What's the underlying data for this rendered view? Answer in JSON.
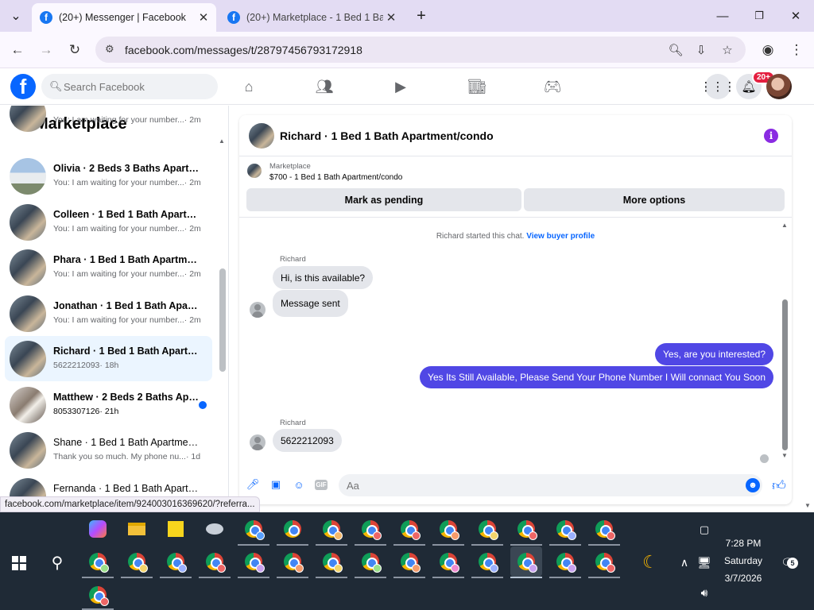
{
  "browser": {
    "tabs": [
      {
        "title": "(20+) Messenger | Facebook",
        "active": true
      },
      {
        "title": "(20+) Marketplace - 1 Bed 1 Bat",
        "active": false
      }
    ],
    "url": "facebook.com/messages/t/28797456793172918",
    "status_url": "facebook.com/marketplace/item/924003016369620/?referra..."
  },
  "facebook": {
    "search_placeholder": "Search Facebook",
    "notification_badge": "20+",
    "brand_color": "#0866ff"
  },
  "sidebar": {
    "title": "Marketplace",
    "conversations": [
      {
        "name": "",
        "preview": "You: I am waiting for your number...",
        "time": " · 2m",
        "unread": false,
        "partial": true
      },
      {
        "name": "Olivia · 2 Beds 3 Baths Apartme...",
        "preview": "You: I am waiting for your number...",
        "time": " · 2m",
        "unread": false
      },
      {
        "name": "Colleen · 1 Bed 1 Bath Apartmen...",
        "preview": "You: I am waiting for your number...",
        "time": " · 2m",
        "unread": false
      },
      {
        "name": "Phara · 1 Bed 1 Bath Apartment/...",
        "preview": "You: I am waiting for your number...",
        "time": " · 2m",
        "unread": false
      },
      {
        "name": "Jonathan · 1 Bed 1 Bath Apartm...",
        "preview": "You: I am waiting for your number...",
        "time": " · 2m",
        "unread": false
      },
      {
        "name": "Richard · 1 Bed 1 Bath Apartmen...",
        "preview": "5622212093",
        "time": " · 18h",
        "unread": false,
        "active": true
      },
      {
        "name": "Matthew · 2 Beds 2 Baths Apa...",
        "preview": "8053307126",
        "time": " · 21h",
        "unread": true
      },
      {
        "name": "Shane · 1 Bed 1 Bath Apartment...",
        "preview": "Thank you so much. My phone nu...",
        "time": " · 1d",
        "unread": false
      },
      {
        "name": "Fernanda · 1 Bed 1 Bath Apartm...",
        "preview": "",
        "time": "",
        "unread": false
      }
    ]
  },
  "chat": {
    "title": "Richard · 1 Bed 1 Bath Apartment/condo",
    "listing": {
      "source": "Marketplace",
      "description": "$700 - 1 Bed 1 Bath Apartment/condo",
      "mark_pending_label": "Mark as pending",
      "more_options_label": "More options"
    },
    "system_note": "Richard started this chat.",
    "system_link": "View buyer profile",
    "messages": [
      {
        "sender": "Richard",
        "text": "Hi, is this available?",
        "dir": "in"
      },
      {
        "sender": "",
        "text": "Message sent",
        "dir": "in"
      },
      {
        "sender": "",
        "text": "Yes, are you interested?",
        "dir": "out"
      },
      {
        "sender": "",
        "text": "Yes Its Still Available, Please Send Your Phone Number I Will connact You Soon",
        "dir": "out"
      },
      {
        "sender": "Richard",
        "text": "5622212093",
        "dir": "in"
      }
    ],
    "composer_placeholder": "Aa",
    "outgoing_color": "#5047e5"
  },
  "taskbar": {
    "time": "7:28 PM",
    "day": "Saturday",
    "date": "3/7/2026",
    "notification_count": "5"
  }
}
